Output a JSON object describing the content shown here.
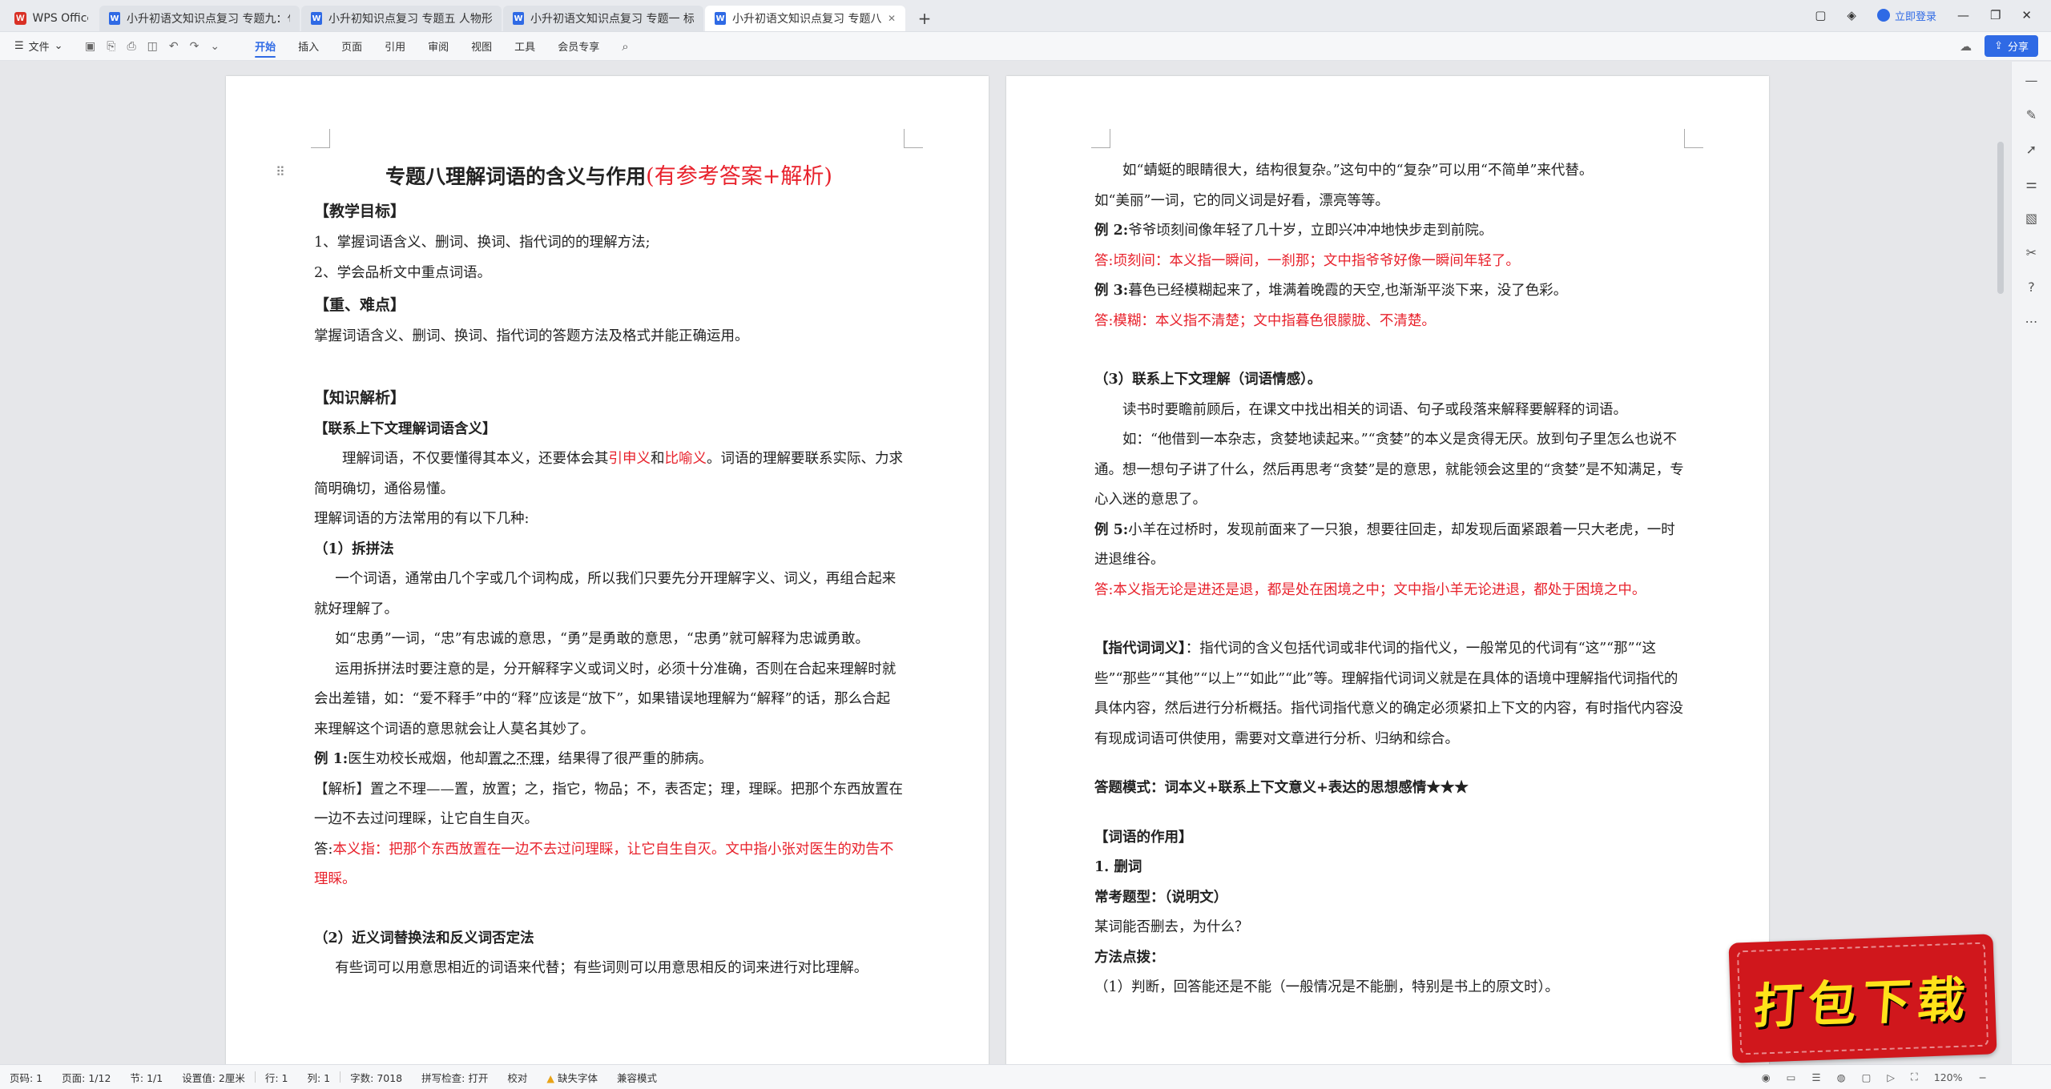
{
  "tabs": {
    "home": "WPS Office",
    "docs": [
      {
        "label": "小升初语文知识点复习 专题九：句...",
        "active": false
      },
      {
        "label": "小升初知识点复习 专题五 人物形象...",
        "active": false
      },
      {
        "label": "小升初语文知识点复习 专题一 标点...",
        "active": false
      },
      {
        "label": "小升初语文知识点复习 专题八",
        "active": true
      }
    ],
    "login": "立即登录"
  },
  "ribbon": {
    "file": "文件",
    "tabs": [
      "开始",
      "插入",
      "页面",
      "引用",
      "审阅",
      "视图",
      "工具",
      "会员专享"
    ],
    "active_tab": "开始",
    "share": "分享"
  },
  "page1": {
    "title_black": "专题八理解词语的含义与作用",
    "title_red": "(有参考答案+解析)",
    "teach_goal": "【教学目标】",
    "goal1": "1、掌握词语含义、删词、换词、指代词的的理解方法;",
    "goal2": "2、学会品析文中重点词语。",
    "key_points": "【重、难点】",
    "key_text": "掌握词语含义、删词、换词、指代词的答题方法及格式并能正确运用。",
    "knowledge": "【知识解析】",
    "context_head": "【联系上下文理解词语含义】",
    "intro_a": "理解词语，不仅要懂得其本义，还要体会其",
    "intro_red1": "引申义",
    "intro_and": "和",
    "intro_red2": "比喻义",
    "intro_b": "。词语的理解要联系实际、力求简明确切，通俗易懂。",
    "methods": "理解词语的方法常用的有以下几种:",
    "m1": "（1）拆拼法",
    "m1_p1": "一个词语，通常由几个字或几个词构成，所以我们只要先分开理解字义、词义，再组合起来就好理解了。",
    "m1_p2": "如“忠勇”一词，“忠”有忠诚的意思，“勇”是勇敢的意思，“忠勇”就可解释为忠诚勇敢。",
    "m1_p3": "运用拆拼法时要注意的是，分开解释字义或词义时，必须十分准确，否则在合起来理解时就会出差错，如：“爱不释手”中的“释”应该是“放下”，如果错误地理解为“解释”的话，那么合起来理解这个词语的意思就会让人莫名其妙了。",
    "ex1_label": "例 1:",
    "ex1_a": "医生劝校长戒烟，他却",
    "ex1_dotted": "置之不理",
    "ex1_b": "，结果得了很严重的肺病。",
    "ana_label": "【解析】",
    "ana_text": "置之不理——置，放置；之，指它，物品；不，表否定；理，理睬。把那个东西放置在一边不去过问理睬，让它自生自灭。",
    "ans_label": "答:",
    "ans_text": "本义指：把那个东西放置在一边不去过问理睬，让它自生自灭。文中指小张对医生的劝告不理睬。",
    "m2": "（2）近义词替换法和反义词否定法",
    "m2_p1": "有些词可以用意思相近的词语来代替；有些词则可以用意思相反的词来进行对比理解。"
  },
  "page2": {
    "p1": "如“蜻蜓的眼睛很大，结构很复杂。”这句中的“复杂”可以用“不简单”来代替。",
    "p2": "如“美丽”一词，它的同义词是好看，漂亮等等。",
    "ex2_label": "例 2:",
    "ex2": "爷爷顷刻间像年轻了几十岁，立即兴冲冲地快步走到前院。",
    "ans2_label": "答:",
    "ans2": "顷刻间：本义指一瞬间，一刹那；文中指爷爷好像一瞬间年轻了。",
    "ex3_label": "例 3:",
    "ex3": "暮色已经模糊起来了，堆满着晚霞的天空,也渐渐平淡下来，没了色彩。",
    "ans3_label": "答:",
    "ans3": "模糊：本义指不清楚；文中指暮色很朦胧、不清楚。",
    "m3": "（3）联系上下文理解（词语情感）。",
    "m3_p1": "读书时要瞻前顾后，在课文中找出相关的词语、句子或段落来解释要解释的词语。",
    "m3_p2": "如：“他借到一本杂志，贪婪地读起来。”“贪婪”的本义是贪得无厌。放到句子里怎么也说不通。想一想句子讲了什么，然后再思考“贪婪”是的意思，就能领会这里的“贪婪”是不知满足，专心入迷的意思了。",
    "ex5_label": "例 5:",
    "ex5": "小羊在过桥时，发现前面来了一只狼，想要往回走，却发现后面紧跟着一只大老虎，一时进退维谷。",
    "ans5_label": "答:",
    "ans5": "本义指无论是进还是退，都是处在困境之中；文中指小羊无论进退，都处于困境之中。",
    "pron_label": "【指代词词义】",
    "pron_text": "：指代词的含义包括代词或非代词的指代义，一般常见的代词有“这”“那”“这些”“那些”“其他”“以上”“如此”“此”等。理解指代词词义就是在具体的语境中理解指代词指代的具体内容，然后进行分析概括。指代词指代意义的确定必须紧扣上下文的内容，有时指代内容没有现成词语可供使用，需要对文章进行分析、归纳和综合。",
    "mode": "答题模式：词本义+联系上下文意义+表达的思想感情★★★",
    "role_head": "【词语的作用】",
    "del": "1. 删词",
    "q_type": "常考题型：（说明文）",
    "q": "某词能否删去，为什么？",
    "tips": "方法点拨：",
    "tip1": "（1）判断，回答能还是不能（一般情况是不能删，特别是书上的原文时）。"
  },
  "status": {
    "page": "页码: 1",
    "pages": "页面: 1/12",
    "section": "节: 1/1",
    "setting": "设置值: 2厘米",
    "row": "行: 1",
    "col": "列: 1",
    "words": "字数: 7018",
    "spell": "拼写检查: 打开",
    "proof": "校对",
    "font_missing": "缺失字体",
    "compat": "兼容模式",
    "zoom": "120%"
  },
  "badge": "打包下载",
  "colors": {
    "accent": "#2f6ae5",
    "red_text": "#e8222c",
    "badge_bg": "#d0171c",
    "badge_text": "#ffe21a"
  }
}
